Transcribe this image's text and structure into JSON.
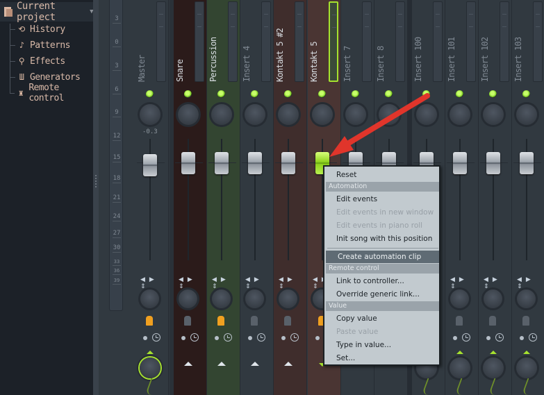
{
  "browser": {
    "header": "Current project",
    "items": [
      {
        "label": "History",
        "icon": "history-icon"
      },
      {
        "label": "Patterns",
        "icon": "note-icon"
      },
      {
        "label": "Effects",
        "icon": "plug-icon"
      },
      {
        "label": "Generators",
        "icon": "keyboard-icon"
      },
      {
        "label": "Remote control",
        "icon": "knob-icon"
      }
    ]
  },
  "mixer": {
    "scale_labels": [
      "3",
      "0",
      "3",
      "6",
      "9",
      "12",
      "15",
      "18",
      "21",
      "24",
      "27",
      "30",
      "33",
      "36",
      "39"
    ],
    "master_volume": "-0.3",
    "tracks": [
      {
        "name": "Master",
        "color": "#313940",
        "label_color": "#7f8892"
      },
      {
        "name": "Snare",
        "color": "#2b1b1a",
        "label_color": "#d9dee3"
      },
      {
        "name": "Percussion",
        "color": "#334531",
        "label_color": "#d9dee3"
      },
      {
        "name": "Insert 4",
        "color": "#313940",
        "label_color": "#7f8892"
      },
      {
        "name": "Kontakt 5 #2",
        "color": "#3f2d2c",
        "label_color": "#d9dee3"
      },
      {
        "name": "Kontakt 5",
        "color": "#4a3533",
        "label_color": "#d9dee3",
        "selected": true
      },
      {
        "name": "Insert 7",
        "color": "#313940",
        "label_color": "#7f8892"
      },
      {
        "name": "Insert 8",
        "color": "#313940",
        "label_color": "#7f8892"
      },
      {
        "name": "Insert 100",
        "color": "#313940",
        "label_color": "#7f8892"
      },
      {
        "name": "Insert 101",
        "color": "#313940",
        "label_color": "#7f8892"
      },
      {
        "name": "Insert 102",
        "color": "#313940",
        "label_color": "#7f8892"
      },
      {
        "name": "Insert 103",
        "color": "#313940",
        "label_color": "#7f8892"
      }
    ]
  },
  "context_menu": {
    "items": [
      {
        "type": "item",
        "label": "Reset"
      },
      {
        "type": "section",
        "label": "Automation"
      },
      {
        "type": "item",
        "label": "Edit events"
      },
      {
        "type": "item",
        "label": "Edit events in new window",
        "disabled": true
      },
      {
        "type": "item",
        "label": "Edit events in piano roll",
        "disabled": true
      },
      {
        "type": "item",
        "label": "Init song with this position"
      },
      {
        "type": "item",
        "label": "Create automation clip",
        "highlighted": true
      },
      {
        "type": "section",
        "label": "Remote control"
      },
      {
        "type": "item",
        "label": "Link to controller..."
      },
      {
        "type": "item",
        "label": "Override generic link..."
      },
      {
        "type": "section",
        "label": "Value"
      },
      {
        "type": "item",
        "label": "Copy value"
      },
      {
        "type": "item",
        "label": "Paste value",
        "disabled": true
      },
      {
        "type": "item",
        "label": "Type in value..."
      },
      {
        "type": "item",
        "label": "Set..."
      }
    ]
  },
  "colors": {
    "accent_green": "#a6e22e",
    "annotation_arrow": "#e0352b",
    "fx_active": "#f0a020"
  }
}
